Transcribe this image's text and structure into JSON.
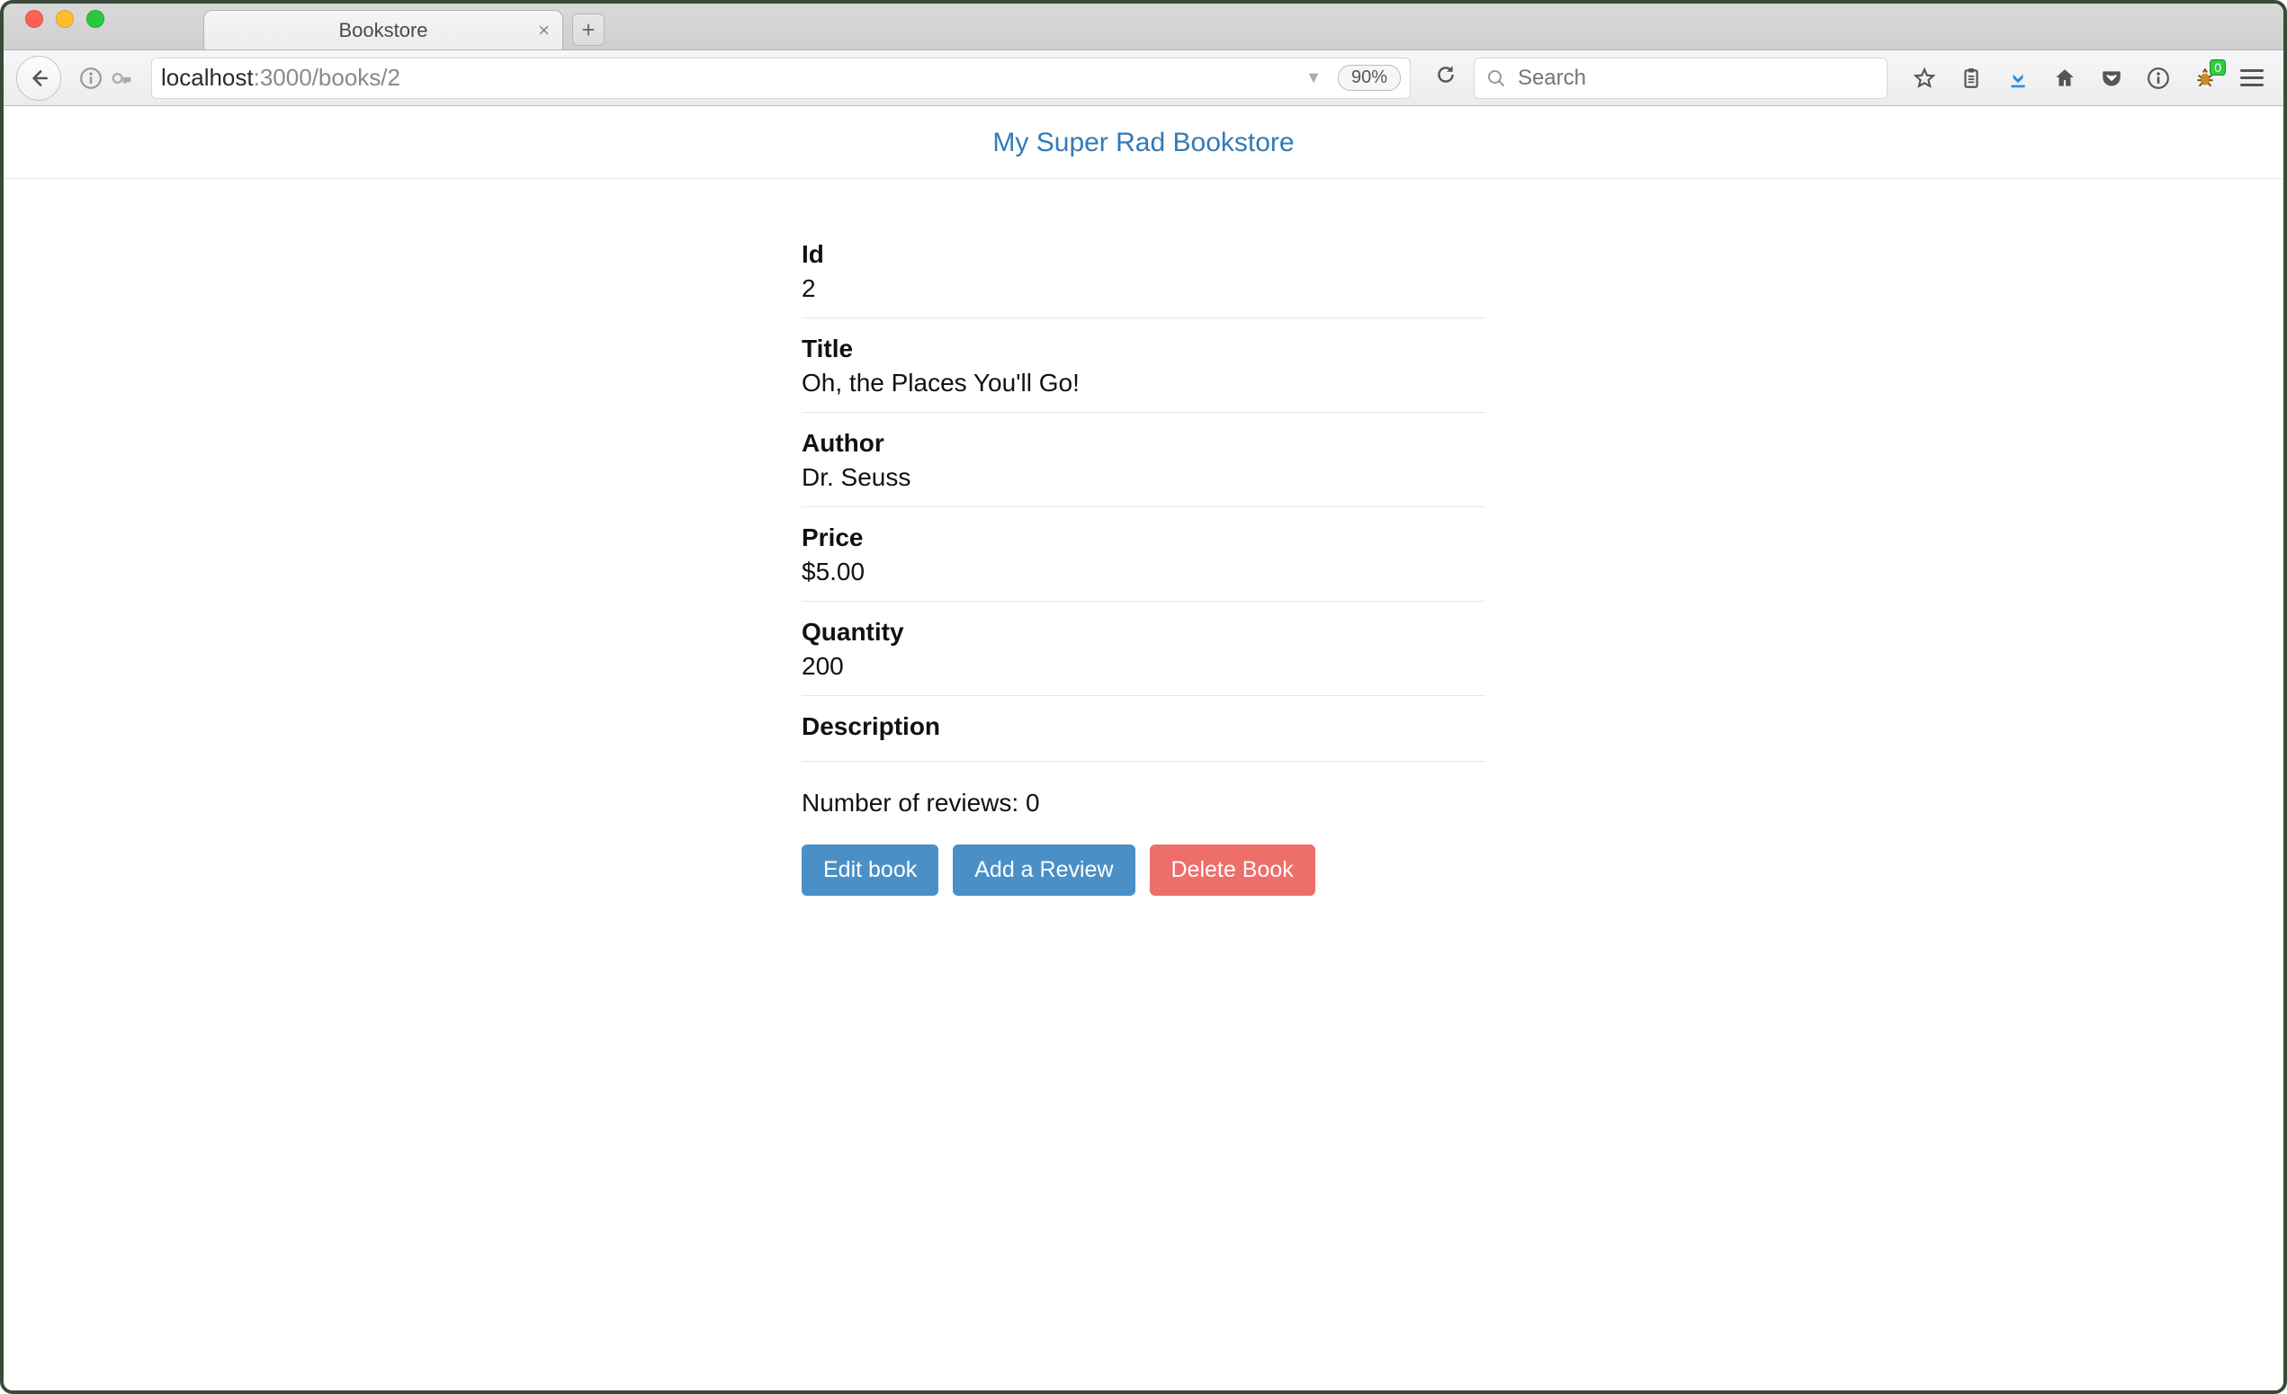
{
  "browser": {
    "tab_title": "Bookstore",
    "url_host": "localhost",
    "url_path": ":3000/books/2",
    "zoom": "90%",
    "search_placeholder": "Search",
    "download_badge": "0"
  },
  "page": {
    "site_title": "My Super Rad Bookstore",
    "fields": {
      "id": {
        "label": "Id",
        "value": "2"
      },
      "title": {
        "label": "Title",
        "value": "Oh, the Places You'll Go!"
      },
      "author": {
        "label": "Author",
        "value": "Dr. Seuss"
      },
      "price": {
        "label": "Price",
        "value": "$5.00"
      },
      "quantity": {
        "label": "Quantity",
        "value": "200"
      },
      "description": {
        "label": "Description",
        "value": ""
      }
    },
    "reviews_line": "Number of reviews: 0",
    "buttons": {
      "edit": "Edit book",
      "review": "Add a Review",
      "delete": "Delete Book"
    }
  }
}
